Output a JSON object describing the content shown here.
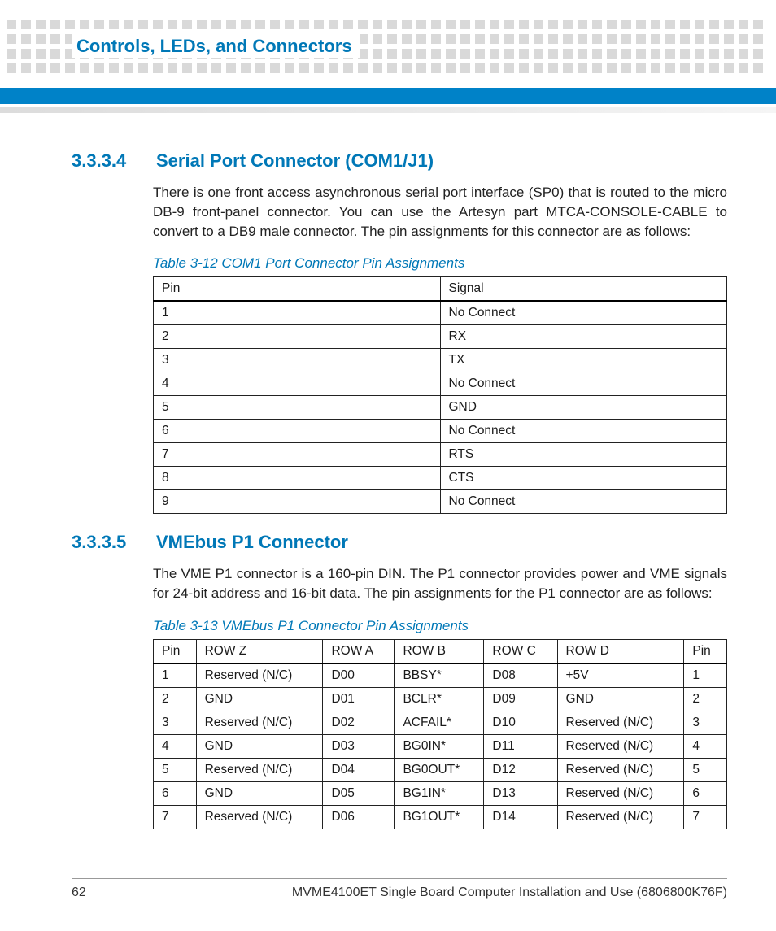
{
  "header": {
    "chapter_title": "Controls, LEDs, and Connectors"
  },
  "section1": {
    "number": "3.3.3.4",
    "title": "Serial Port Connector (COM1/J1)",
    "body": "There is one front access asynchronous serial port interface (SP0) that is routed to the micro DB-9 front-panel connector.   You can use the Artesyn part MTCA-CONSOLE-CABLE to convert to a DB9 male connector. The pin assignments for this connector are as follows:",
    "table_caption": "Table 3-12 COM1 Port Connector Pin Assignments",
    "table": {
      "head": [
        "Pin",
        "Signal"
      ],
      "rows": [
        [
          "1",
          "No Connect"
        ],
        [
          "2",
          "RX"
        ],
        [
          "3",
          "TX"
        ],
        [
          "4",
          "No Connect"
        ],
        [
          "5",
          "GND"
        ],
        [
          "6",
          "No Connect"
        ],
        [
          "7",
          "RTS"
        ],
        [
          "8",
          "CTS"
        ],
        [
          "9",
          "No Connect"
        ]
      ]
    }
  },
  "section2": {
    "number": "3.3.3.5",
    "title": "VMEbus P1 Connector",
    "body": "The VME P1 connector is a 160-pin DIN. The P1 connector provides power and VME signals for 24-bit address and 16-bit data. The pin assignments for the P1 connector are as follows:",
    "table_caption": "Table 3-13 VMEbus P1 Connector Pin Assignments",
    "table": {
      "head": [
        "Pin",
        "ROW Z",
        "ROW A",
        "ROW B",
        "ROW C",
        "ROW D",
        "Pin"
      ],
      "rows": [
        [
          "1",
          "Reserved (N/C)",
          "D00",
          "BBSY*",
          "D08",
          "+5V",
          "1"
        ],
        [
          "2",
          "GND",
          "D01",
          "BCLR*",
          "D09",
          "GND",
          "2"
        ],
        [
          "3",
          "Reserved (N/C)",
          "D02",
          "ACFAIL*",
          "D10",
          "Reserved (N/C)",
          "3"
        ],
        [
          "4",
          "GND",
          "D03",
          "BG0IN*",
          "D11",
          "Reserved (N/C)",
          "4"
        ],
        [
          "5",
          "Reserved (N/C)",
          "D04",
          "BG0OUT*",
          "D12",
          "Reserved (N/C)",
          "5"
        ],
        [
          "6",
          "GND",
          "D05",
          "BG1IN*",
          "D13",
          "Reserved (N/C)",
          "6"
        ],
        [
          "7",
          "Reserved (N/C)",
          "D06",
          "BG1OUT*",
          "D14",
          "Reserved (N/C)",
          "7"
        ]
      ]
    }
  },
  "footer": {
    "page": "62",
    "doc": "MVME4100ET Single Board Computer Installation and Use (6806800K76F)"
  }
}
